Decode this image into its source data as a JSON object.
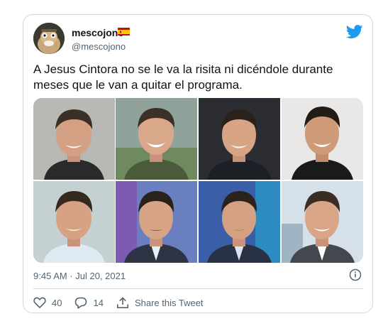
{
  "user": {
    "display_name": "mescojono",
    "handle": "@mescojono",
    "flag_icon": "spain-flag-icon",
    "avatar_icon": "avatar"
  },
  "tweet": {
    "text": "A Jesus Cintora no se le va la risita ni dicéndole durante meses que le van a quitar el programa.",
    "timestamp": "9:45 AM · Jul 20, 2021"
  },
  "actions": {
    "likes": "40",
    "replies": "14",
    "share_label": "Share this Tweet"
  },
  "media": {
    "photo_count": 8,
    "backgrounds": [
      "#b8b9b4",
      "#8fa39a",
      "#2b2d33",
      "#e9e8e6",
      "#c5d0d2",
      "#6a7fbf",
      "#3a5ea8",
      "#d6e0e8"
    ],
    "suits": [
      "#2a2a2a",
      "#4c5a3c",
      "#1d1f26",
      "#1a1a1a",
      "#dfe9f2",
      "#2f3444",
      "#293144",
      "#43474f"
    ]
  },
  "colors": {
    "accent": "#1d9bf0",
    "text_secondary": "#536471",
    "border": "#cfd9de"
  },
  "icons": {
    "brand": "twitter-bird-icon",
    "info": "info-icon",
    "like": "heart-icon",
    "reply": "reply-icon",
    "share": "share-icon"
  }
}
